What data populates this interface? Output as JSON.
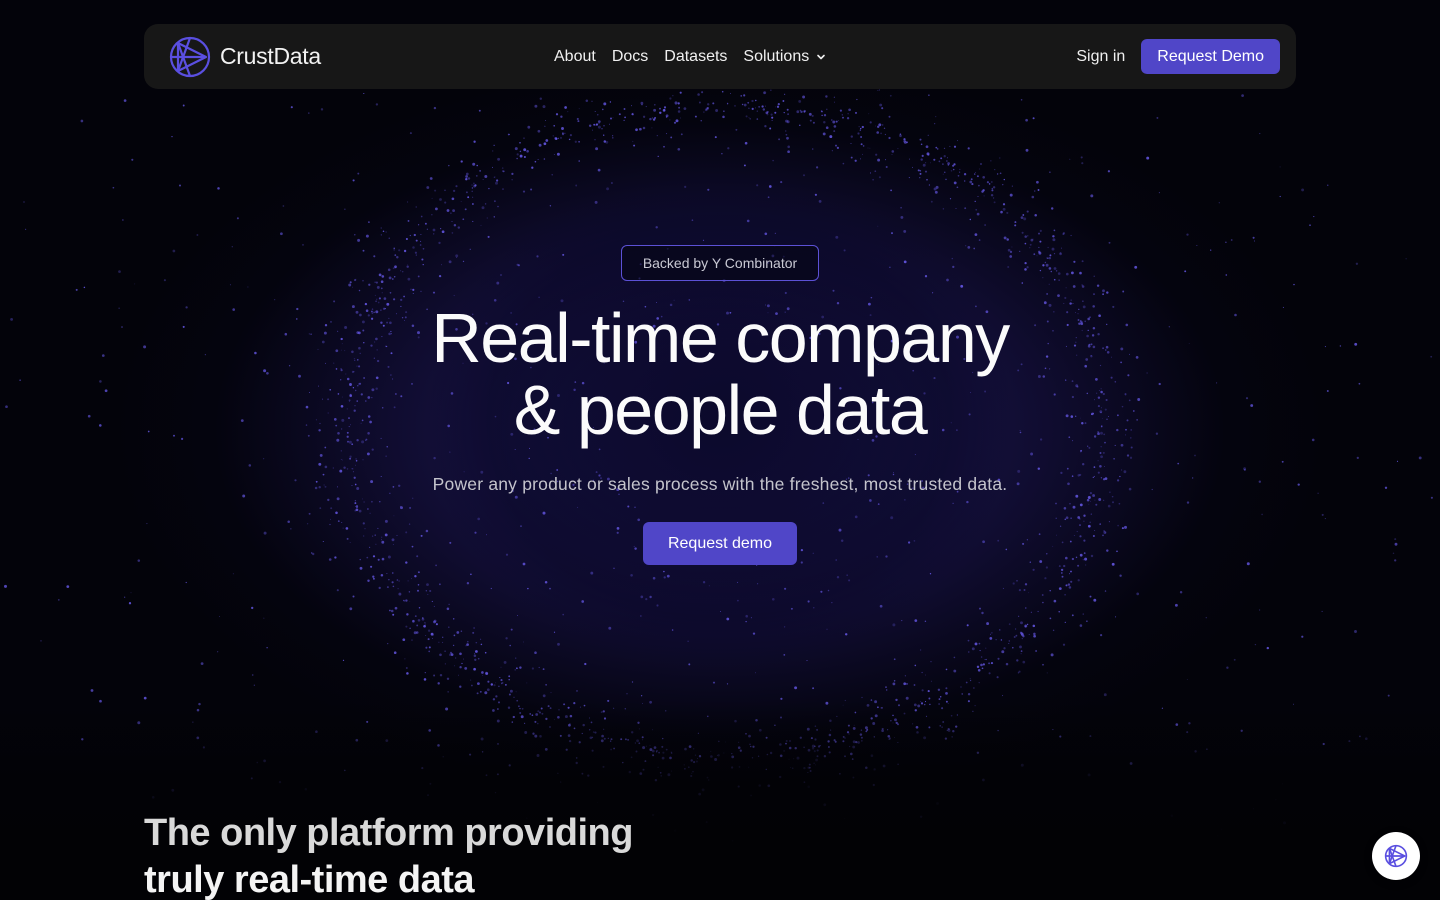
{
  "brand": {
    "name": "CrustData",
    "accent": "#5046c8"
  },
  "nav": {
    "links": [
      "About",
      "Docs",
      "Datasets",
      "Solutions"
    ],
    "signin": "Sign in",
    "cta": "Request Demo"
  },
  "hero": {
    "badge": "Backed by Y Combinator",
    "title_line1": "Real-time company",
    "title_line2": "& people data",
    "subtitle": "Power any product or sales process with the freshest, most trusted data.",
    "cta": "Request demo"
  },
  "section": {
    "heading_line1": "The only platform providing",
    "heading_line2": "truly real-time data"
  },
  "icons": {
    "logo": "crustdata-logo-icon",
    "dropdown": "chevron-down-icon",
    "chat": "crustdata-chat-icon"
  }
}
